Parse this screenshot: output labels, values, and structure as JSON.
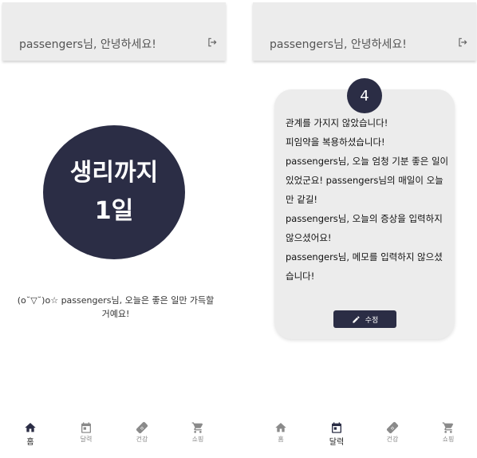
{
  "left": {
    "header": {
      "greeting": "passengers님, 안녕하세요!",
      "logout_icon": "logout-icon"
    },
    "period": {
      "line1": "생리까지",
      "line2": "1일"
    },
    "message": "(o˘▽˘)o☆ passengers님, 오늘은 좋은 일만 가득할거예요!",
    "nav": [
      {
        "label": "홈",
        "icon": "home-icon",
        "active": true
      },
      {
        "label": "달력",
        "icon": "calendar-icon",
        "active": false
      },
      {
        "label": "건강",
        "icon": "bandage-icon",
        "active": false
      },
      {
        "label": "쇼핑",
        "icon": "cart-icon",
        "active": false
      }
    ]
  },
  "right": {
    "header": {
      "greeting": "passengers님, 안녕하세요!",
      "logout_icon": "logout-icon"
    },
    "day_number": "4",
    "status_lines": [
      "관계를 가지지 않았습니다!",
      "피임약을 복용하셨습니다!",
      "passengers님, 오늘 엄청 기분 좋은 일이 있었군요! passengers님의 매일이 오늘만 같길!",
      "passengers님, 오늘의 증상을 입력하지 않으셨어요!",
      "passengers님, 메모를 입력하지 않으셨습니다!"
    ],
    "edit_button": {
      "label": "수정",
      "icon": "pencil-icon"
    },
    "nav": [
      {
        "label": "홈",
        "icon": "home-icon",
        "active": false
      },
      {
        "label": "달력",
        "icon": "calendar-icon",
        "active": true
      },
      {
        "label": "건강",
        "icon": "bandage-icon",
        "active": false
      },
      {
        "label": "쇼핑",
        "icon": "cart-icon",
        "active": false
      }
    ]
  }
}
